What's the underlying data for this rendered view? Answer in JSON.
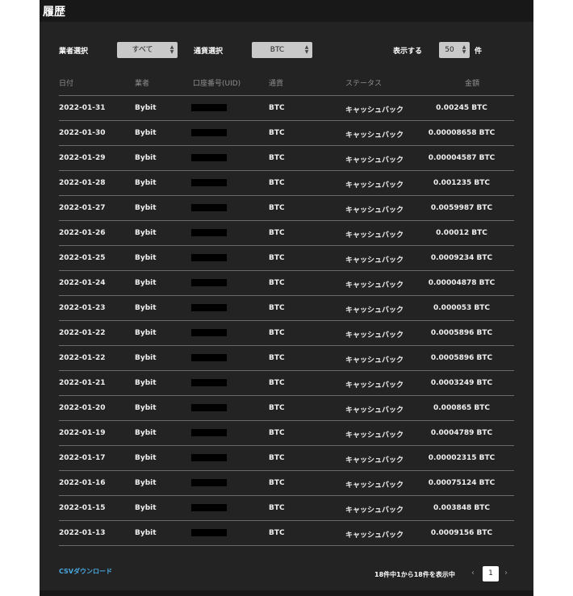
{
  "page": {
    "title": "履歴"
  },
  "filters": {
    "vendor_label": "業者選択",
    "vendor_value": "すべて",
    "currency_label": "通貨選択",
    "currency_value": "BTC",
    "show_label": "表示する",
    "show_value": "50",
    "show_unit": "件"
  },
  "table": {
    "headers": [
      "日付",
      "業者",
      "口座番号(UID)",
      "通貨",
      "ステータス",
      "金額"
    ],
    "rows": [
      {
        "date": "2022-01-31",
        "vendor": "Bybit",
        "currency": "BTC",
        "status": "キャッシュバック",
        "amount": "0.00245 BTC"
      },
      {
        "date": "2022-01-30",
        "vendor": "Bybit",
        "currency": "BTC",
        "status": "キャッシュバック",
        "amount": "0.00008658 BTC"
      },
      {
        "date": "2022-01-29",
        "vendor": "Bybit",
        "currency": "BTC",
        "status": "キャッシュバック",
        "amount": "0.00004587 BTC"
      },
      {
        "date": "2022-01-28",
        "vendor": "Bybit",
        "currency": "BTC",
        "status": "キャッシュバック",
        "amount": "0.001235 BTC"
      },
      {
        "date": "2022-01-27",
        "vendor": "Bybit",
        "currency": "BTC",
        "status": "キャッシュバック",
        "amount": "0.0059987 BTC"
      },
      {
        "date": "2022-01-26",
        "vendor": "Bybit",
        "currency": "BTC",
        "status": "キャッシュバック",
        "amount": "0.00012 BTC"
      },
      {
        "date": "2022-01-25",
        "vendor": "Bybit",
        "currency": "BTC",
        "status": "キャッシュバック",
        "amount": "0.0009234 BTC"
      },
      {
        "date": "2022-01-24",
        "vendor": "Bybit",
        "currency": "BTC",
        "status": "キャッシュバック",
        "amount": "0.00004878 BTC"
      },
      {
        "date": "2022-01-23",
        "vendor": "Bybit",
        "currency": "BTC",
        "status": "キャッシュバック",
        "amount": "0.000053 BTC"
      },
      {
        "date": "2022-01-22",
        "vendor": "Bybit",
        "currency": "BTC",
        "status": "キャッシュバック",
        "amount": "0.0005896 BTC"
      },
      {
        "date": "2022-01-22",
        "vendor": "Bybit",
        "currency": "BTC",
        "status": "キャッシュバック",
        "amount": "0.0005896 BTC"
      },
      {
        "date": "2022-01-21",
        "vendor": "Bybit",
        "currency": "BTC",
        "status": "キャッシュバック",
        "amount": "0.0003249 BTC"
      },
      {
        "date": "2022-01-20",
        "vendor": "Bybit",
        "currency": "BTC",
        "status": "キャッシュバック",
        "amount": "0.000865 BTC"
      },
      {
        "date": "2022-01-19",
        "vendor": "Bybit",
        "currency": "BTC",
        "status": "キャッシュバック",
        "amount": "0.0004789 BTC"
      },
      {
        "date": "2022-01-17",
        "vendor": "Bybit",
        "currency": "BTC",
        "status": "キャッシュバック",
        "amount": "0.00002315 BTC"
      },
      {
        "date": "2022-01-16",
        "vendor": "Bybit",
        "currency": "BTC",
        "status": "キャッシュバック",
        "amount": "0.00075124 BTC"
      },
      {
        "date": "2022-01-15",
        "vendor": "Bybit",
        "currency": "BTC",
        "status": "キャッシュバック",
        "amount": "0.003848 BTC"
      },
      {
        "date": "2022-01-13",
        "vendor": "Bybit",
        "currency": "BTC",
        "status": "キャッシュバック",
        "amount": "0.0009156 BTC"
      }
    ]
  },
  "footer": {
    "csv_label": "CSVダウンロード",
    "page_info": "18件中1から18件を表示中",
    "prev": "‹",
    "current_page": "1",
    "next": "›"
  }
}
